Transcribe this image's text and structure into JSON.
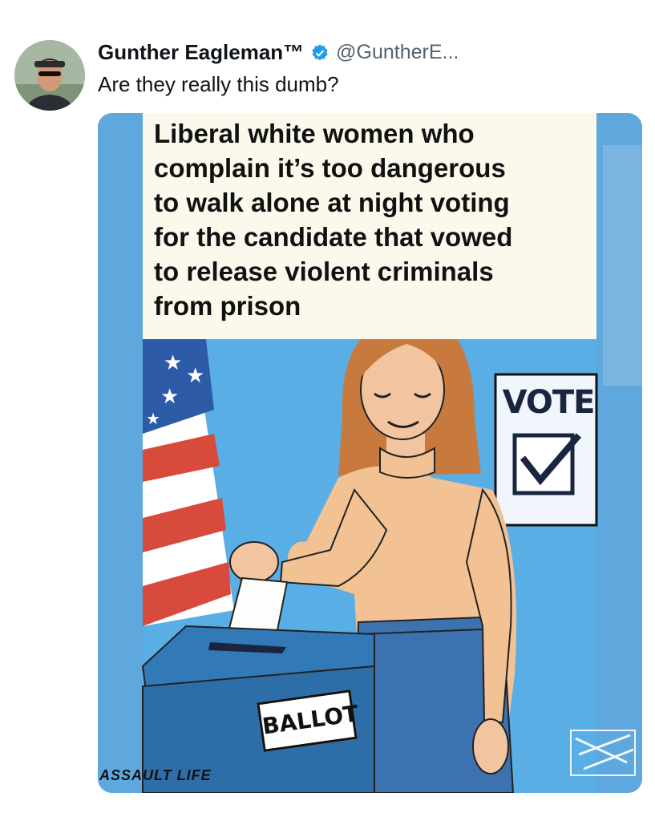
{
  "tweet": {
    "author_name": "Gunther Eagleman™",
    "handle": "@GuntherE...",
    "text": "Are they really this dumb?",
    "verified_icon": "verified-badge-icon",
    "verified_color": "#1d9bf0"
  },
  "media": {
    "caption": "Liberal white women who\ncomplain it’s too dangerous\nto walk alone at night voting\nfor the candidate that vowed\nto release violent criminals\nfrom prison",
    "vote_sign": "VOTE",
    "ballot_label": "BALLOT",
    "watermark": "ASSAULT LIFE"
  },
  "colors": {
    "background": "#ffffff",
    "sky_blue": "#5aaee6",
    "caption_bg": "#fbf8ec"
  }
}
